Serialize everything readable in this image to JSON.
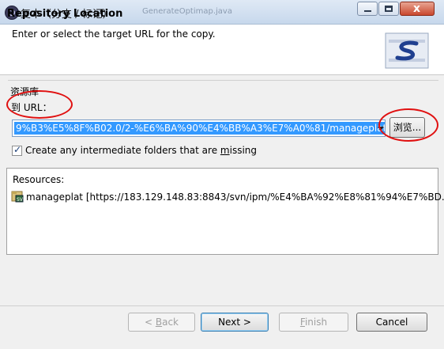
{
  "window": {
    "title": "复本（分支 / 标记）",
    "background_title": "GenerateOptimap.java",
    "close_label": "x"
  },
  "header": {
    "title": "Repository Location",
    "description": "Enter or select the target URL for the copy."
  },
  "group": {
    "label": "资源库",
    "url_label": "到 URL：",
    "url_value": "9%B3%E5%8F%B02.0/2-%E6%BA%90%E4%BB%A3%E7%A0%81/manageplat",
    "browse_label": "浏览...",
    "create_folders_checked": true,
    "create_folders_label": "Create any intermediate folders that are missing"
  },
  "resources": {
    "title": "Resources:",
    "items": [
      {
        "text": "manageplat [https://183.129.148.83:8843/svn/ipm/%E4%BA%92%E8%81%94%E7%BD..."
      }
    ]
  },
  "buttons": {
    "back": "< Back",
    "next": "Next >",
    "finish": "Finish",
    "cancel": "Cancel"
  },
  "colors": {
    "selection": "#3399ff",
    "annotation": "#e01010"
  }
}
